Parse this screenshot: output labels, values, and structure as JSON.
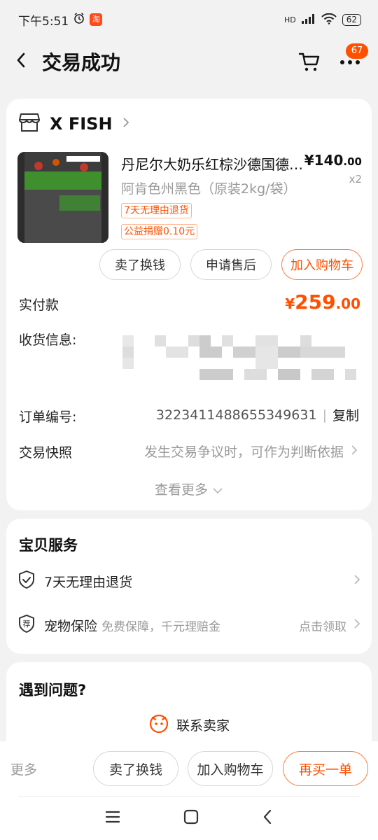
{
  "status_bar": {
    "time": "下午5:51",
    "app_badge": "淘",
    "network": "HD",
    "battery": "62"
  },
  "nav": {
    "title": "交易成功",
    "message_count": "67"
  },
  "order": {
    "shop_name": "X FISH",
    "product": {
      "title": "丹尼尔大奶乐红棕沙德国德…",
      "price_main": "¥140",
      "price_decimal": ".00",
      "quantity": "x2",
      "spec": "阿肯色州黑色（原装2kg/袋）",
      "tags": [
        "7天无理由退货",
        "公益捐赠0.10元"
      ],
      "image_brand": "DENNERLE",
      "image_text": "Nano Garnelenkies"
    },
    "actions": {
      "sell_label": "卖了换钱",
      "after_sale_label": "申请售后",
      "add_cart_label": "加入购物车"
    },
    "paid": {
      "label": "实付款",
      "symbol": "¥",
      "main": "259",
      "decimal": ".00"
    },
    "shipping": {
      "label": "收货信息:"
    },
    "order_number": {
      "label": "订单编号:",
      "value": "3223411488655349631",
      "copy_label": "复制"
    },
    "snapshot": {
      "label": "交易快照",
      "desc": "发生交易争议时，可作为判断依据"
    },
    "see_more": "查看更多"
  },
  "service": {
    "title": "宝贝服务",
    "items": [
      {
        "label": "7天无理由退货",
        "sub": "",
        "right": ""
      },
      {
        "label": "宠物保险",
        "sub": "免费保障，千元理赔金",
        "right": "点击领取"
      }
    ]
  },
  "help": {
    "title": "遇到问题?",
    "contact_label": "联系卖家"
  },
  "bottom": {
    "more_label": "更多",
    "sell_label": "卖了换钱",
    "add_cart_label": "加入购物车",
    "rebuy_label": "再买一单"
  },
  "colors": {
    "accent": "#ff5000",
    "background": "#f2f2f2"
  }
}
